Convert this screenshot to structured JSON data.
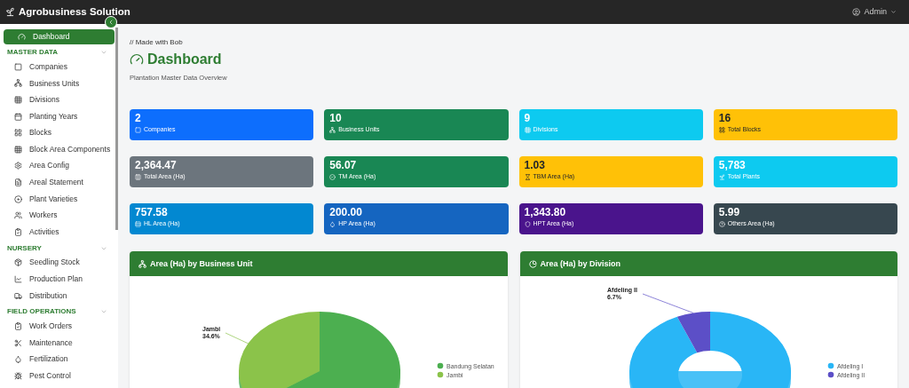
{
  "topbar": {
    "brand": "Agrobusiness Solution",
    "user": "Admin"
  },
  "sidebar": {
    "items": [
      {
        "label": "Dashboard",
        "selected": true
      }
    ],
    "sections": [
      {
        "title": "MASTER DATA",
        "items": [
          {
            "label": "Companies",
            "selected": false
          },
          {
            "label": "Business Units",
            "selected": false
          },
          {
            "label": "Divisions",
            "selected": false
          },
          {
            "label": "Planting Years",
            "selected": false
          },
          {
            "label": "Blocks",
            "selected": false
          },
          {
            "label": "Block Area Components",
            "selected": false
          },
          {
            "label": "Area Config",
            "selected": false
          },
          {
            "label": "Areal Statement",
            "selected": false
          },
          {
            "label": "Plant Varieties",
            "selected": false
          },
          {
            "label": "Workers",
            "selected": false
          },
          {
            "label": "Activities",
            "selected": false
          }
        ]
      },
      {
        "title": "NURSERY",
        "items": [
          {
            "label": "Seedling Stock",
            "selected": false
          },
          {
            "label": "Production Plan",
            "selected": false
          },
          {
            "label": "Distribution",
            "selected": false
          }
        ]
      },
      {
        "title": "FIELD OPERATIONS",
        "items": [
          {
            "label": "Work Orders",
            "selected": false
          },
          {
            "label": "Maintenance",
            "selected": false
          },
          {
            "label": "Fertilization",
            "selected": false
          },
          {
            "label": "Pest Control",
            "selected": false
          }
        ]
      }
    ]
  },
  "header": {
    "comment": "// Made with Bob",
    "title": "Dashboard",
    "subtitle": "Plantation Master Data Overview"
  },
  "cards": [
    {
      "value": "2",
      "label": "Companies",
      "color": "#0d6efd"
    },
    {
      "value": "10",
      "label": "Business Units",
      "color": "#198754"
    },
    {
      "value": "9",
      "label": "Divisions",
      "color": "#0dcaf0"
    },
    {
      "value": "16",
      "label": "Total Blocks",
      "color": "#ffc107"
    },
    {
      "value": "2,364.47",
      "label": "Total Area (Ha)",
      "color": "#6c757d"
    },
    {
      "value": "56.07",
      "label": "TM Area (Ha)",
      "color": "#198754"
    },
    {
      "value": "1.03",
      "label": "TBM Area (Ha)",
      "color": "#ffc107"
    },
    {
      "value": "5,783",
      "label": "Total Plants",
      "color": "#0dcaf0"
    },
    {
      "value": "757.58",
      "label": "HL Area (Ha)",
      "color": "#0288d1"
    },
    {
      "value": "200.00",
      "label": "HP Area (Ha)",
      "color": "#1565c0"
    },
    {
      "value": "1,343.80",
      "label": "HPT Area (Ha)",
      "color": "#4a148c"
    },
    {
      "value": "5.99",
      "label": "Others Area (Ha)",
      "color": "#37474f"
    }
  ],
  "charts": [
    {
      "title": "Area (Ha) by Business Unit",
      "kind": "pie",
      "slice_label": {
        "name": "Jambi",
        "percent": "34.6%"
      },
      "legend": [
        {
          "label": "Bandung Selatan",
          "color": "#4caf50"
        },
        {
          "label": "Jambi",
          "color": "#8bc34a"
        }
      ]
    },
    {
      "title": "Area (Ha) by Division",
      "kind": "donut",
      "slice_label": {
        "name": "Afdeling II",
        "percent": "6.7%"
      },
      "legend": [
        {
          "label": "Afdeling I",
          "color": "#29b6f6"
        },
        {
          "label": "Afdeling II",
          "color": "#5c4fc7"
        }
      ]
    }
  ]
}
